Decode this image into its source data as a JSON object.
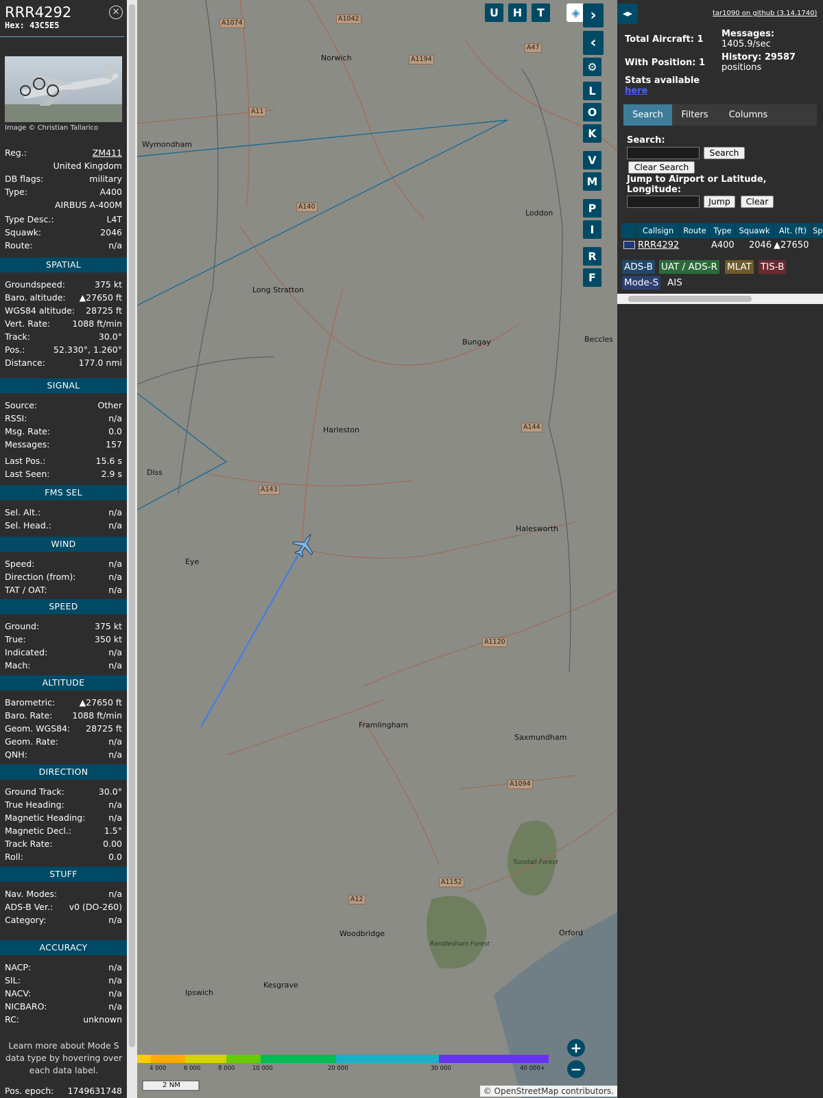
{
  "sidebar": {
    "callsign": "RRR4292",
    "hex_label": "Hex:",
    "hex": "43C5E5",
    "close": "×",
    "photo_credit": "Image © Christian Tallarico",
    "info": [
      {
        "k": "Reg.:",
        "v": "ZM411"
      },
      {
        "k": "",
        "v": "United Kingdom"
      },
      {
        "k": "DB flags:",
        "v": "military"
      },
      {
        "k": "Type:",
        "v": "A400"
      },
      {
        "k": "",
        "v": "AIRBUS A-400M"
      },
      {
        "k": "Type Desc.:",
        "v": "L4T"
      },
      {
        "k": "Squawk:",
        "v": "2046"
      },
      {
        "k": "Route:",
        "v": "n/a"
      }
    ],
    "sections": [
      {
        "title": "SPATIAL",
        "rows": [
          {
            "k": "Groundspeed:",
            "v": "375 kt"
          },
          {
            "k": "Baro. altitude:",
            "v": "▲27650 ft"
          },
          {
            "k": "WGS84 altitude:",
            "v": "28725 ft"
          },
          {
            "k": "Vert. Rate:",
            "v": "1088 ft/min"
          },
          {
            "k": "Track:",
            "v": "30.0°"
          },
          {
            "k": "Pos.:",
            "v": "52.330°, 1.260°"
          },
          {
            "k": "Distance:",
            "v": "177.0 nmi"
          }
        ]
      },
      {
        "title": "SIGNAL",
        "rows": [
          {
            "k": "Source:",
            "v": "Other"
          },
          {
            "k": "RSSI:",
            "v": "n/a"
          },
          {
            "k": "Msg. Rate:",
            "v": "0.0"
          },
          {
            "k": "Messages:",
            "v": "157"
          },
          {
            "k": "Last Pos.:",
            "v": "15.6 s"
          },
          {
            "k": "Last Seen:",
            "v": "2.9 s"
          }
        ]
      },
      {
        "title": "FMS SEL",
        "rows": [
          {
            "k": "Sel. Alt.:",
            "v": "n/a"
          },
          {
            "k": "Sel. Head.:",
            "v": "n/a"
          }
        ]
      },
      {
        "title": "WIND",
        "rows": [
          {
            "k": "Speed:",
            "v": "n/a"
          },
          {
            "k": "Direction (from):",
            "v": "n/a"
          },
          {
            "k": "TAT / OAT:",
            "v": "n/a"
          }
        ]
      },
      {
        "title": "SPEED",
        "rows": [
          {
            "k": "Ground:",
            "v": "375 kt"
          },
          {
            "k": "True:",
            "v": "350 kt"
          },
          {
            "k": "Indicated:",
            "v": "n/a"
          },
          {
            "k": "Mach:",
            "v": "n/a"
          }
        ]
      },
      {
        "title": "ALTITUDE",
        "rows": [
          {
            "k": "Barometric:",
            "v": "▲27650 ft"
          },
          {
            "k": "Baro. Rate:",
            "v": "1088 ft/min"
          },
          {
            "k": "Geom. WGS84:",
            "v": "28725 ft"
          },
          {
            "k": "Geom. Rate:",
            "v": "n/a"
          },
          {
            "k": "QNH:",
            "v": "n/a"
          }
        ]
      },
      {
        "title": "DIRECTION",
        "rows": [
          {
            "k": "Ground Track:",
            "v": "30.0°"
          },
          {
            "k": "True Heading:",
            "v": "n/a"
          },
          {
            "k": "Magnetic Heading:",
            "v": "n/a"
          },
          {
            "k": "Magnetic Decl.:",
            "v": "1.5°"
          },
          {
            "k": "Track Rate:",
            "v": "0.00"
          },
          {
            "k": "Roll:",
            "v": "0.0"
          }
        ]
      },
      {
        "title": "STUFF",
        "rows": [
          {
            "k": "Nav. Modes:",
            "v": "n/a"
          },
          {
            "k": "ADS-B Ver.:",
            "v": "v0 (DO-260)"
          },
          {
            "k": "Category:",
            "v": "n/a"
          }
        ]
      },
      {
        "title": "ACCURACY",
        "rows": [
          {
            "k": "NACP:",
            "v": "n/a"
          },
          {
            "k": "SIL:",
            "v": "n/a"
          },
          {
            "k": "NACV:",
            "v": "n/a"
          },
          {
            "k": "NICBARO:",
            "v": "n/a"
          },
          {
            "k": "RC:",
            "v": "unknown"
          }
        ]
      }
    ],
    "note": "Learn more about Mode S data type by hovering over each data label.",
    "epoch_label": "Pos. epoch:",
    "epoch": "1749631748"
  },
  "map": {
    "places": [
      "Norwich",
      "Wymondham",
      "Loddon",
      "Long Stratton",
      "Bungay",
      "Harleston",
      "Diss",
      "Eye",
      "Halesworth",
      "Framlingham",
      "Saxmundham",
      "Woodbridge",
      "Orford",
      "Kesgrave",
      "Ipswich",
      "Beccles",
      "Tunstall Forest",
      "Rendlesham Forest"
    ],
    "roads": [
      "A1074",
      "A1042",
      "A1194",
      "A47",
      "A11",
      "A140",
      "A143",
      "A144",
      "A1120",
      "A1094",
      "A1152",
      "A12"
    ],
    "buttons": [
      "U",
      "H",
      "T",
      "L",
      "O",
      "K",
      "V",
      "M",
      "P",
      "I",
      "R",
      "F"
    ],
    "legend_ticks": [
      "4 000",
      "6 000",
      "8 000",
      "10 000",
      "20 000",
      "30 000",
      "40 000+"
    ],
    "scale": "2 NM",
    "attribution": "© OpenStreetMap contributors.",
    "zoom_in": "+",
    "zoom_out": "−"
  },
  "panel": {
    "github": "tar1090 on github (3.14.1740)",
    "total_aircraft": "Total Aircraft: 1",
    "with_position": "With Position: 1",
    "messages_label": "Messages:",
    "messages": "1405.9/sec",
    "history_label": "History: 29587",
    "history_unit": "positions",
    "stats": "Stats available",
    "stats_link": "here",
    "tabs": [
      "Search",
      "Filters",
      "Columns"
    ],
    "search_label": "Search:",
    "search_button": "Search",
    "clear_search": "Clear Search",
    "jump_label": "Jump to Airport or Latitude, Longitude:",
    "jump_button": "Jump",
    "clear_button": "Clear",
    "columns": [
      "Callsign",
      "Route",
      "Type",
      "Squawk",
      "Alt. (ft)",
      "Sp"
    ],
    "row": {
      "callsign": "RRR4292",
      "route": "",
      "type": "A400",
      "squawk": "2046",
      "alt": "▲27650"
    },
    "sources": [
      "ADS-B",
      "UAT / ADS-R",
      "MLAT",
      "TIS-B",
      "Mode-S",
      "AIS"
    ]
  },
  "colors": {
    "accent": "#004a66",
    "track": "#3a7cf0",
    "sidebar_bg": "#2d2d2d"
  }
}
